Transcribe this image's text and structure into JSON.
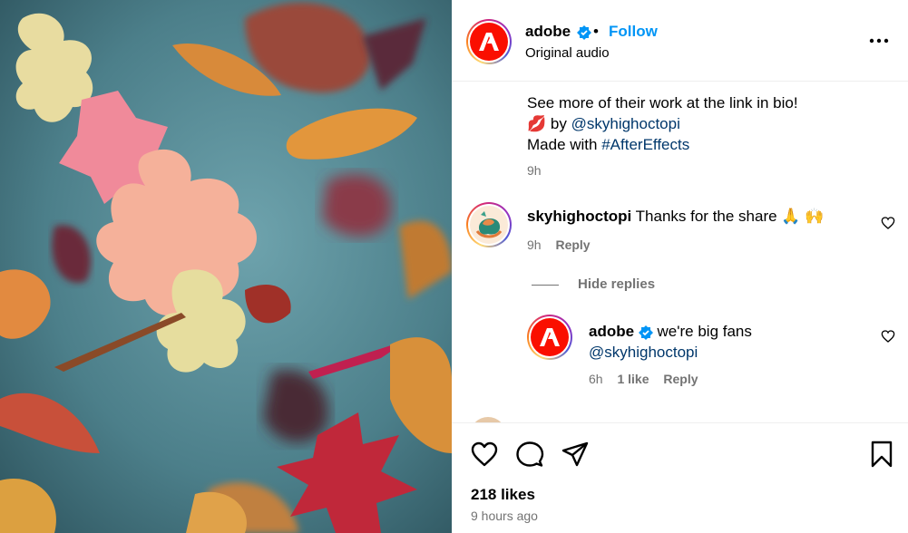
{
  "post": {
    "author": "adobe",
    "follow_label": "Follow",
    "separator": "•",
    "audio": "Original audio"
  },
  "caption": {
    "line1": "See more of their work at the link in bio!",
    "line2_emoji": "💋",
    "line2_by": "by",
    "line2_mention": "@skyhighoctopi",
    "line3_text": "Made with",
    "line3_hashtag": "#AfterEffects",
    "time": "9h"
  },
  "comments": [
    {
      "username": "skyhighoctopi",
      "text": "Thanks for the share 🙏 🙌",
      "time": "9h",
      "reply_label": "Reply"
    }
  ],
  "hide_replies_label": "Hide replies",
  "replies": [
    {
      "username": "adobe",
      "text": "we're big fans",
      "mention": "@skyhighoctopi",
      "time": "6h",
      "likes": "1 like",
      "reply_label": "Reply"
    }
  ],
  "footer": {
    "likes": "218 likes",
    "time": "9 hours ago"
  },
  "colors": {
    "follow": "#0095f6",
    "adobe_red": "#fa0f00",
    "muted": "#737373",
    "link": "#00376b"
  },
  "icons": {
    "like": "heart-icon",
    "comment": "comment-icon",
    "share": "share-icon",
    "save": "bookmark-icon",
    "more": "more-options-icon"
  }
}
